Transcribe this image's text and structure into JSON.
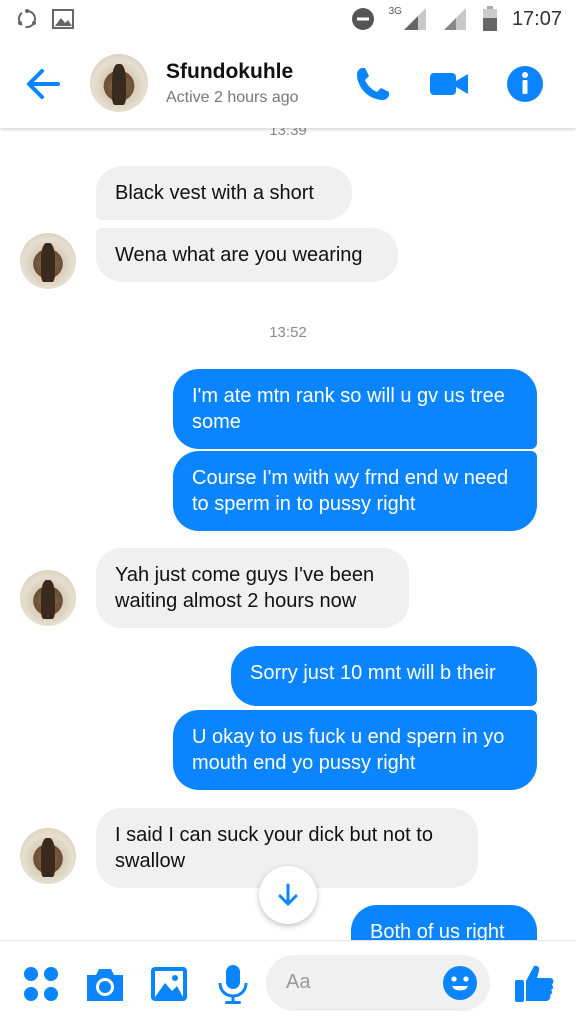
{
  "status_bar": {
    "network": "3G",
    "time": "17:07"
  },
  "header": {
    "name": "Sfundokuhle",
    "status": "Active 2 hours ago"
  },
  "chat": {
    "clipped_timestamp": "13:39",
    "timestamp_2": "13:52",
    "messages": [
      {
        "text": "Black vest with a short"
      },
      {
        "text": "Wena what are you wearing"
      },
      {
        "text": "I'm ate mtn rank so will u gv us tree some"
      },
      {
        "text": "Course I'm with wy frnd end w need to sperm in to pussy right"
      },
      {
        "text": "Yah just come guys I've been waiting almost 2 hours now"
      },
      {
        "text": "Sorry just 10 mnt will b their"
      },
      {
        "text": "U okay to us fuck u end spern in yo mouth end yo pussy right"
      },
      {
        "text": "I said I can suck your dick but not to swallow"
      },
      {
        "text": "Both of us right"
      }
    ]
  },
  "composer": {
    "placeholder": "Aa"
  },
  "colors": {
    "accent": "#0a84ff",
    "incoming_bubble": "#f0f0f0"
  }
}
